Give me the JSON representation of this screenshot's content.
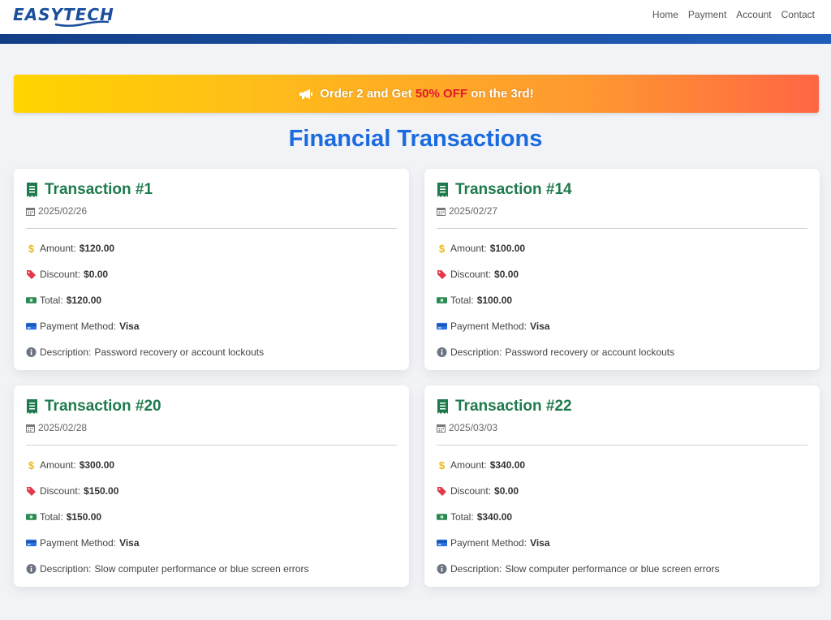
{
  "header": {
    "logo_text": "EASYTECH",
    "nav": [
      "Home",
      "Payment",
      "Account",
      "Contact"
    ]
  },
  "promo": {
    "prefix": "Order 2 and Get ",
    "highlight": "50% OFF",
    "suffix": " on the 3rd!"
  },
  "page_title": "Financial Transactions",
  "labels": {
    "amount": "Amount:",
    "discount": "Discount:",
    "total": "Total:",
    "payment_method": "Payment Method:",
    "description": "Description:"
  },
  "transactions": [
    {
      "title": "Transaction #1",
      "date": "2025/02/26",
      "amount": "$120.00",
      "discount": "$0.00",
      "total": "$120.00",
      "payment_method": "Visa",
      "description": "Password recovery or account lockouts"
    },
    {
      "title": "Transaction #14",
      "date": "2025/02/27",
      "amount": "$100.00",
      "discount": "$0.00",
      "total": "$100.00",
      "payment_method": "Visa",
      "description": "Password recovery or account lockouts"
    },
    {
      "title": "Transaction #20",
      "date": "2025/02/28",
      "amount": "$300.00",
      "discount": "$150.00",
      "total": "$150.00",
      "payment_method": "Visa",
      "description": "Slow computer performance or blue screen errors"
    },
    {
      "title": "Transaction #22",
      "date": "2025/03/03",
      "amount": "$340.00",
      "discount": "$0.00",
      "total": "$340.00",
      "payment_method": "Visa",
      "description": "Slow computer performance or blue screen errors"
    }
  ],
  "colors": {
    "title_blue": "#1a6ae0",
    "card_title_green": "#1e7a4c",
    "promo_highlight": "#e0182d",
    "header_accent": "#1d54a8"
  },
  "icons": {
    "promo": "megaphone-icon",
    "card_title": "receipt-icon",
    "date": "calendar-icon",
    "amount": "dollar-icon",
    "discount": "tag-icon",
    "total": "money-bill-icon",
    "payment_method": "credit-card-icon",
    "description": "info-circle-icon"
  }
}
